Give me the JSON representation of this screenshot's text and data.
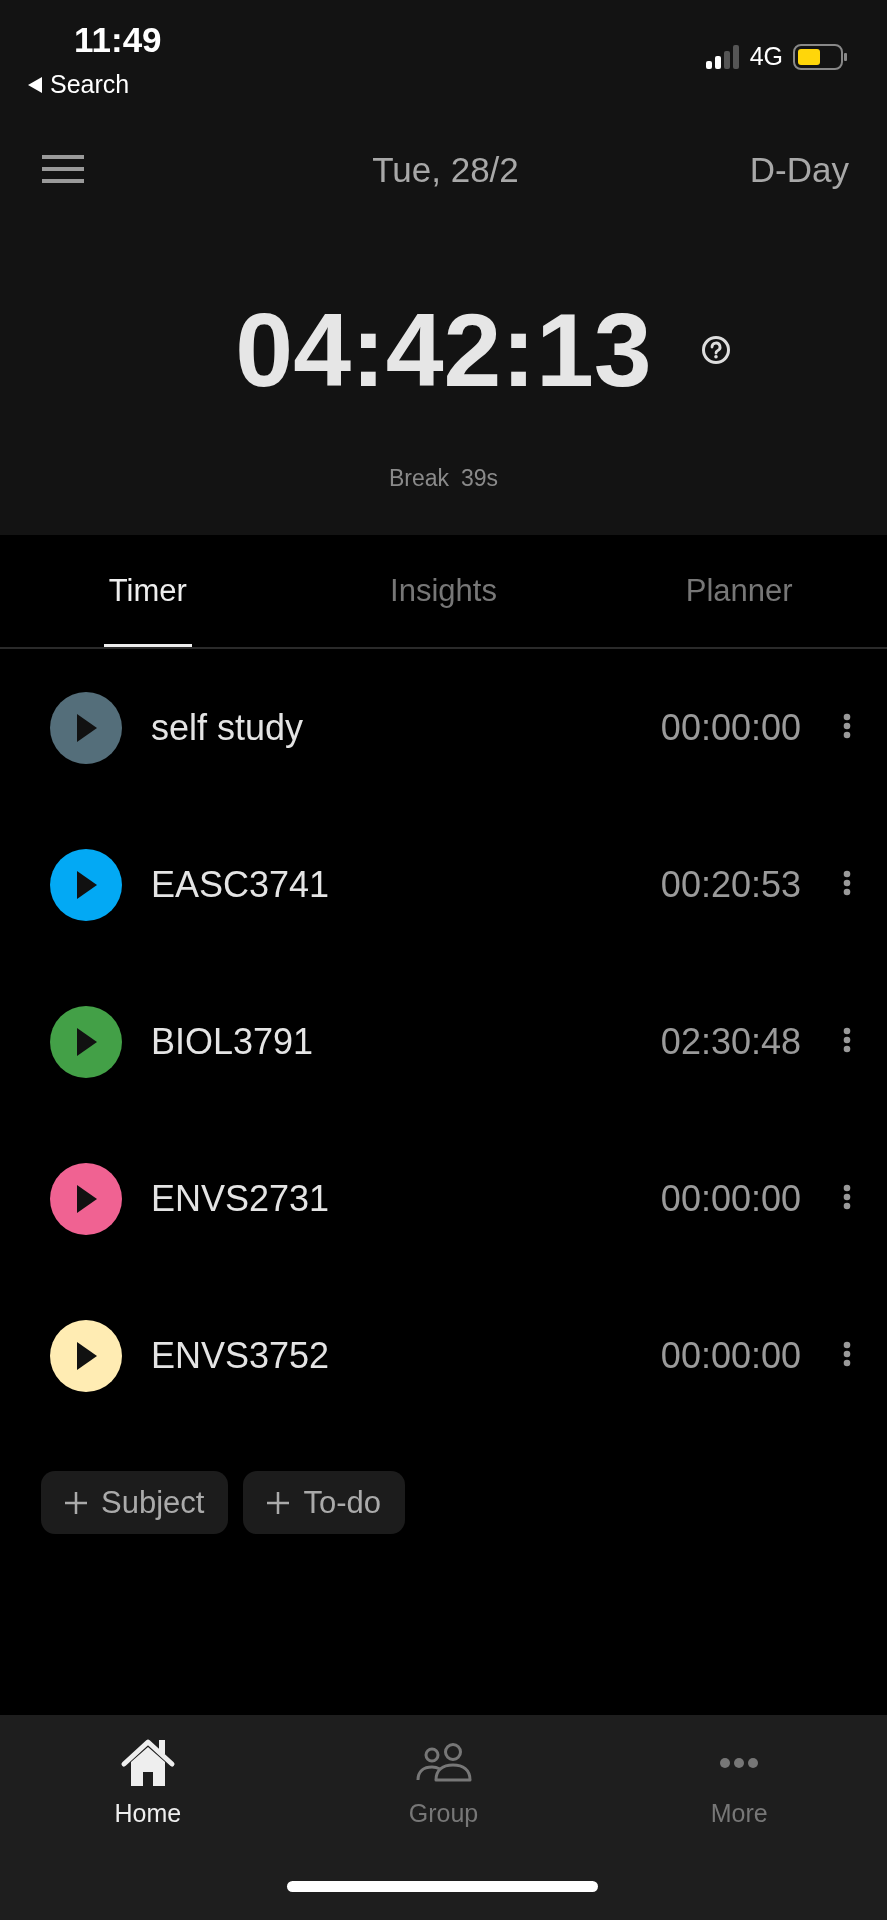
{
  "status_bar": {
    "time": "11:49",
    "back_label": "Search",
    "network": "4G"
  },
  "header": {
    "date": "Tue, 28/2",
    "d_day": "D-Day"
  },
  "timer": {
    "value": "04:42:13",
    "break_label": "Break",
    "break_value": "39s"
  },
  "tabs": [
    {
      "label": "Timer",
      "selected": true
    },
    {
      "label": "Insights",
      "selected": false
    },
    {
      "label": "Planner",
      "selected": false
    }
  ],
  "subjects": [
    {
      "name": "self study",
      "time": "00:00:00",
      "color": "#546e7a"
    },
    {
      "name": "EASC3741",
      "time": "00:20:53",
      "color": "#03a9f4"
    },
    {
      "name": "BIOL3791",
      "time": "02:30:48",
      "color": "#43a047"
    },
    {
      "name": "ENVS2731",
      "time": "00:00:00",
      "color": "#f06292"
    },
    {
      "name": "ENVS3752",
      "time": "00:00:00",
      "color": "#ffecb3"
    }
  ],
  "actions": [
    {
      "label": "Subject"
    },
    {
      "label": "To-do"
    }
  ],
  "bottom_nav": [
    {
      "label": "Home",
      "kind": "home",
      "selected": true
    },
    {
      "label": "Group",
      "kind": "group",
      "selected": false
    },
    {
      "label": "More",
      "kind": "more",
      "selected": false
    }
  ]
}
